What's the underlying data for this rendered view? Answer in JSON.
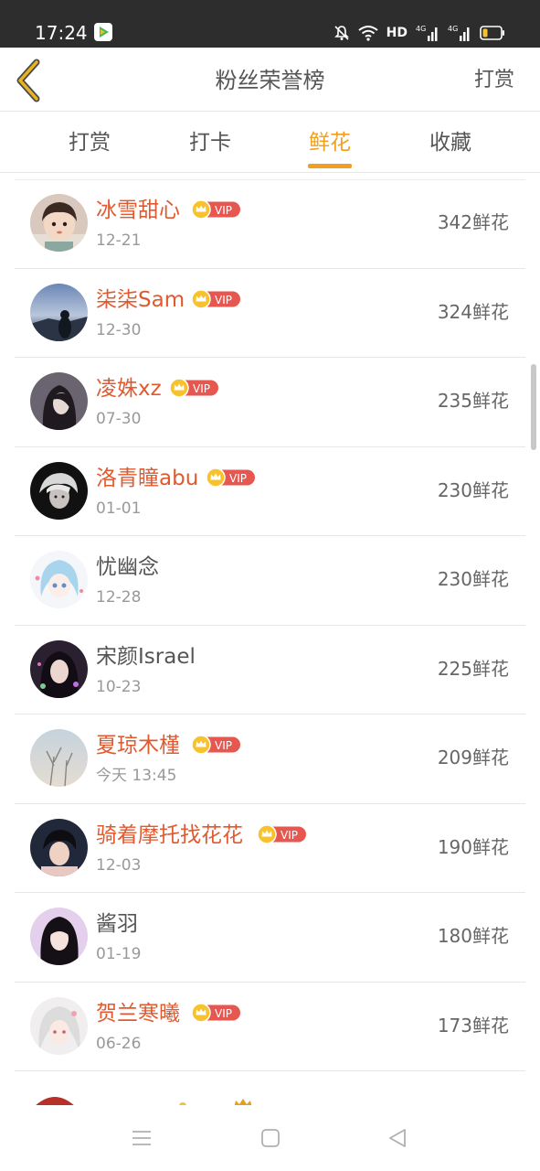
{
  "status_bar": {
    "time": "17:24",
    "network_label": "HD",
    "icons": [
      "app-badge-icon",
      "mute-bell-icon",
      "wifi-icon",
      "signal-4g-icon",
      "signal-4g-icon",
      "battery-icon"
    ]
  },
  "header": {
    "title": "粉丝荣誉榜",
    "action_label": "打赏",
    "back_icon": "chevron-left-icon"
  },
  "tabs": [
    {
      "label": "打赏",
      "active": false
    },
    {
      "label": "打卡",
      "active": false
    },
    {
      "label": "鲜花",
      "active": true
    },
    {
      "label": "收藏",
      "active": false
    }
  ],
  "vip_label": "VIP",
  "fans": [
    {
      "name": "冰雪甜心",
      "date": "12-21",
      "count": "342鲜花",
      "vip": true
    },
    {
      "name": "柒柒Sam",
      "date": "12-30",
      "count": "324鲜花",
      "vip": true
    },
    {
      "name": "凌姝xz",
      "date": "07-30",
      "count": "235鲜花",
      "vip": true
    },
    {
      "name": "洛青瞳abu",
      "date": "01-01",
      "count": "230鲜花",
      "vip": true
    },
    {
      "name": "忧幽念",
      "date": "12-28",
      "count": "230鲜花",
      "vip": false
    },
    {
      "name": "宋颜Israel",
      "date": "10-23",
      "count": "225鲜花",
      "vip": false
    },
    {
      "name": "夏琼木槿",
      "date": "今天 13:45",
      "count": "209鲜花",
      "vip": true
    },
    {
      "name": "骑着摩托找花花",
      "date": "12-03",
      "count": "190鲜花",
      "vip": true
    },
    {
      "name": "酱羽",
      "date": "01-19",
      "count": "180鲜花",
      "vip": false
    },
    {
      "name": "贺兰寒曦",
      "date": "06-26",
      "count": "173鲜花",
      "vip": true
    }
  ],
  "colors": {
    "accent": "#f0a01e",
    "vip_name": "#e05a30",
    "vip_badge": "#e5574f"
  },
  "nav_bar": {
    "icons": [
      "menu-icon",
      "home-square-icon",
      "back-triangle-icon"
    ]
  }
}
